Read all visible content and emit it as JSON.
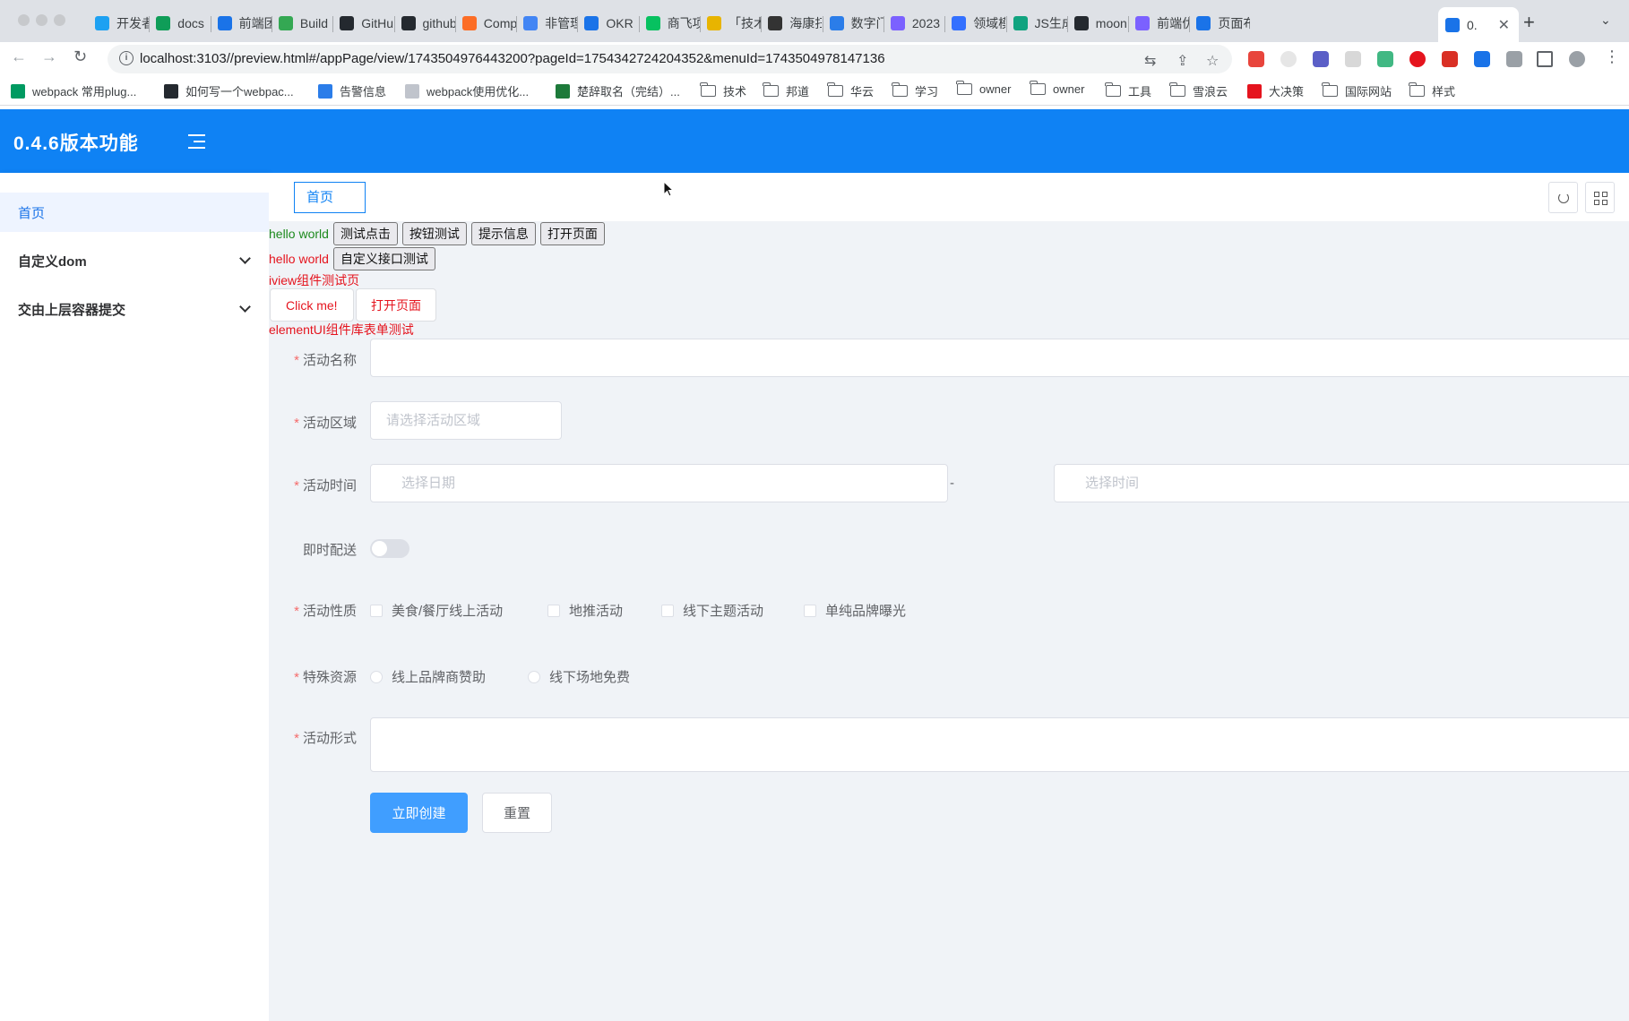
{
  "browser": {
    "tabs": [
      {
        "title": "开发者",
        "color": "#1da1f2"
      },
      {
        "title": "docs",
        "color": "#0f9d58"
      },
      {
        "title": "前端团",
        "color": "#1a73e8"
      },
      {
        "title": "Build",
        "color": "#34a853"
      },
      {
        "title": "GitHub",
        "color": "#24292f"
      },
      {
        "title": "github",
        "color": "#24292f"
      },
      {
        "title": "Comp",
        "color": "#fc6d26"
      },
      {
        "title": "非管理",
        "color": "#4285f4"
      },
      {
        "title": "OKR",
        "color": "#1a73e8"
      },
      {
        "title": "商飞项",
        "color": "#07c160"
      },
      {
        "title": "「技术",
        "color": "#e8b400"
      },
      {
        "title": "海康扫",
        "color": "#333333"
      },
      {
        "title": "数字门",
        "color": "#2b7de9"
      },
      {
        "title": "2023",
        "color": "#7b61ff"
      },
      {
        "title": "领域模",
        "color": "#3370ff"
      },
      {
        "title": "JS生成",
        "color": "#10a37f"
      },
      {
        "title": "moon",
        "color": "#24292f"
      },
      {
        "title": "前端优",
        "color": "#7b61ff"
      },
      {
        "title": "页面布",
        "color": "#1a73e8"
      },
      {
        "title": "0.",
        "color": "#1a73e8"
      }
    ],
    "active_tab_close": "✕",
    "new_tab": "+",
    "url": "localhost:3103//preview.html#/appPage/view/1743504976443200?pageId=1754342724204352&menuId=1743504978147136",
    "bookmarks": [
      {
        "label": "webpack 常用plug...",
        "type": "site",
        "color": "#009a61"
      },
      {
        "label": "如何写一个webpac...",
        "type": "site",
        "color": "#24292f"
      },
      {
        "label": "告警信息",
        "type": "site",
        "color": "#2b7de9"
      },
      {
        "label": "webpack使用优化...",
        "type": "site",
        "color": "#c0c4cc"
      },
      {
        "label": "楚辞取名（完结）...",
        "type": "site",
        "color": "#1d7a3a"
      },
      {
        "label": "技术",
        "type": "folder"
      },
      {
        "label": "邦道",
        "type": "folder"
      },
      {
        "label": "华云",
        "type": "folder"
      },
      {
        "label": "学习",
        "type": "folder"
      },
      {
        "label": "owner",
        "type": "folder"
      },
      {
        "label": "owner",
        "type": "folder"
      },
      {
        "label": "工具",
        "type": "folder"
      },
      {
        "label": "雪浪云",
        "type": "folder"
      },
      {
        "label": "大决策",
        "type": "site",
        "color": "#e5141e"
      },
      {
        "label": "国际网站",
        "type": "folder"
      },
      {
        "label": "样式",
        "type": "folder"
      }
    ]
  },
  "app": {
    "title": "0.4.6版本功能",
    "sidebar": [
      {
        "label": "首页",
        "active": true
      },
      {
        "label": "自定义dom",
        "active": false
      },
      {
        "label": "交由上层容器提交",
        "active": false
      }
    ],
    "tabs": [
      {
        "label": "首页"
      }
    ],
    "hello1": "hello world",
    "hello2": "hello world",
    "buttons_row1": [
      "测试点击",
      "按钮测试",
      "提示信息",
      "打开页面"
    ],
    "buttons_row2": [
      "自定义接口测试"
    ],
    "iview_title": "iview组件测试页",
    "iview_buttons": [
      "Click me!",
      "打开页面"
    ],
    "element_title": "elementUI组件库表单测试",
    "form": {
      "name_label": "活动名称",
      "region_label": "活动区域",
      "region_placeholder": "请选择活动区域",
      "time_label": "活动时间",
      "date_placeholder": "选择日期",
      "time_separator": "-",
      "time_placeholder": "选择时间",
      "delivery_label": "即时配送",
      "type_label": "活动性质",
      "type_options": [
        "美食/餐厅线上活动",
        "地推活动",
        "线下主题活动",
        "单纯品牌曝光"
      ],
      "resource_label": "特殊资源",
      "resource_options": [
        "线上品牌商赞助",
        "线下场地免费"
      ],
      "desc_label": "活动形式",
      "submit": "立即创建",
      "reset": "重置"
    }
  }
}
